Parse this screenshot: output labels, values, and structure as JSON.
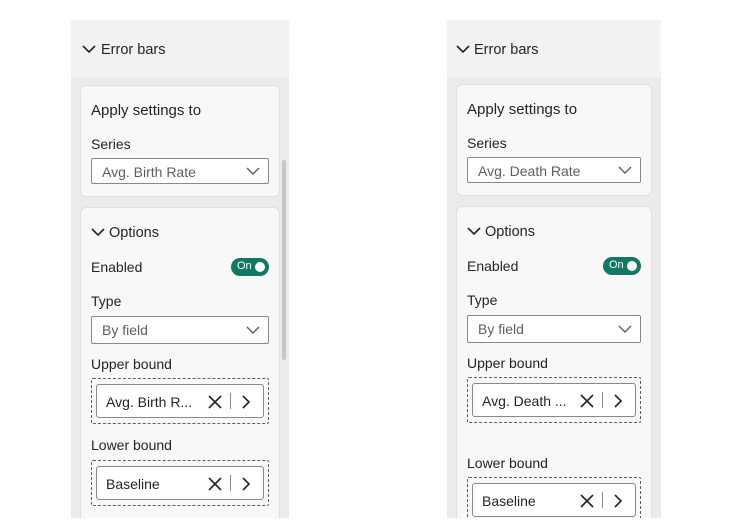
{
  "panels": [
    {
      "section_title": "Error bars",
      "apply_title": "Apply settings to",
      "series_label": "Series",
      "series_value": "Avg. Birth Rate",
      "options_title": "Options",
      "enabled_label": "Enabled",
      "toggle_text": "On",
      "type_label": "Type",
      "type_value": "By field",
      "upper_label": "Upper bound",
      "upper_value": "Avg. Birth R...",
      "lower_label": "Lower bound",
      "lower_value": "Baseline"
    },
    {
      "section_title": "Error bars",
      "apply_title": "Apply settings to",
      "series_label": "Series",
      "series_value": "Avg. Death Rate",
      "options_title": "Options",
      "enabled_label": "Enabled",
      "toggle_text": "On",
      "type_label": "Type",
      "type_value": "By field",
      "upper_label": "Upper bound",
      "upper_value": "Avg. Death ...",
      "lower_label": "Lower bound",
      "lower_value": "Baseline"
    }
  ],
  "icons": {
    "section_chevron": "chevron-down-icon",
    "dropdown_arrow": "chevron-down-icon",
    "remove": "close-icon",
    "navigate": "chevron-right-icon"
  },
  "colors": {
    "toggle_on": "#117865",
    "pane_bg": "#edebe9",
    "card_bg": "#f8f8f8"
  }
}
